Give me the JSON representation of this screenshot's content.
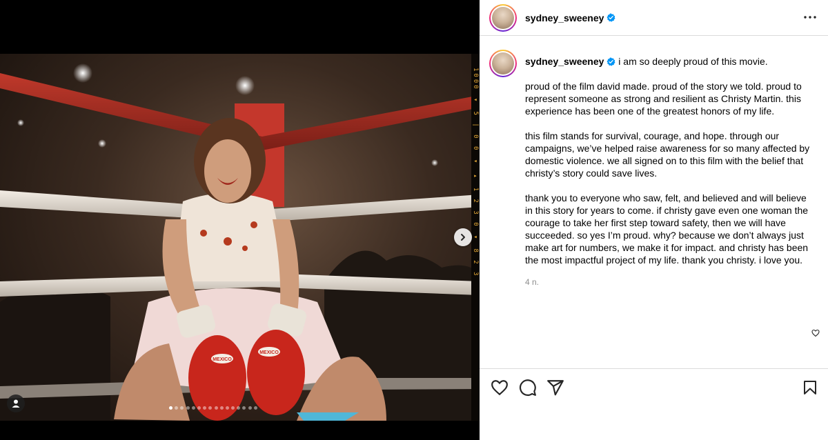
{
  "post": {
    "username": "sydney_sweeney",
    "caption_lead": "i am so deeply proud of this movie.",
    "paragraphs": [
      "proud of the film david made. proud of the story we told. proud to represent someone as strong and resilient as Christy Martin. this experience has been one of the greatest honors of my life.",
      "this film stands for survival, courage, and hope. through our campaigns, we’ve helped raise awareness for so many affected by domestic violence. we all signed on to this film with the belief that christy’s story could save lives.",
      "thank you to everyone who saw, felt, and believed and will believe in this story for years to come. if christy gave even one woman the courage to take her first step toward safety, then we will have succeeded. so yes I’m proud. why? because we don’t always just make art for numbers, we make it for impact. and christy has been the most impactful project of my life. thank you christy. i love you."
    ],
    "timestamp": "4 n."
  },
  "media": {
    "film_edge_text": "1000 ◂ 5 | 0 0 ◂ ▸ 1 2 3 0 ◂ 8 2 3",
    "slide_count": 16,
    "active_slide": 0,
    "glove_brand": "MEXICO"
  },
  "icons": {
    "verified": "verified-badge-icon",
    "more": "more-options-icon",
    "next": "chevron-right-icon",
    "tag": "user-tag-icon",
    "like": "heart-icon",
    "comment": "comment-icon",
    "share": "share-icon",
    "save": "bookmark-icon"
  },
  "colors": {
    "verified_blue": "#0095f6",
    "text_secondary": "#8e8e8e",
    "film_edge": "#e3a736"
  }
}
